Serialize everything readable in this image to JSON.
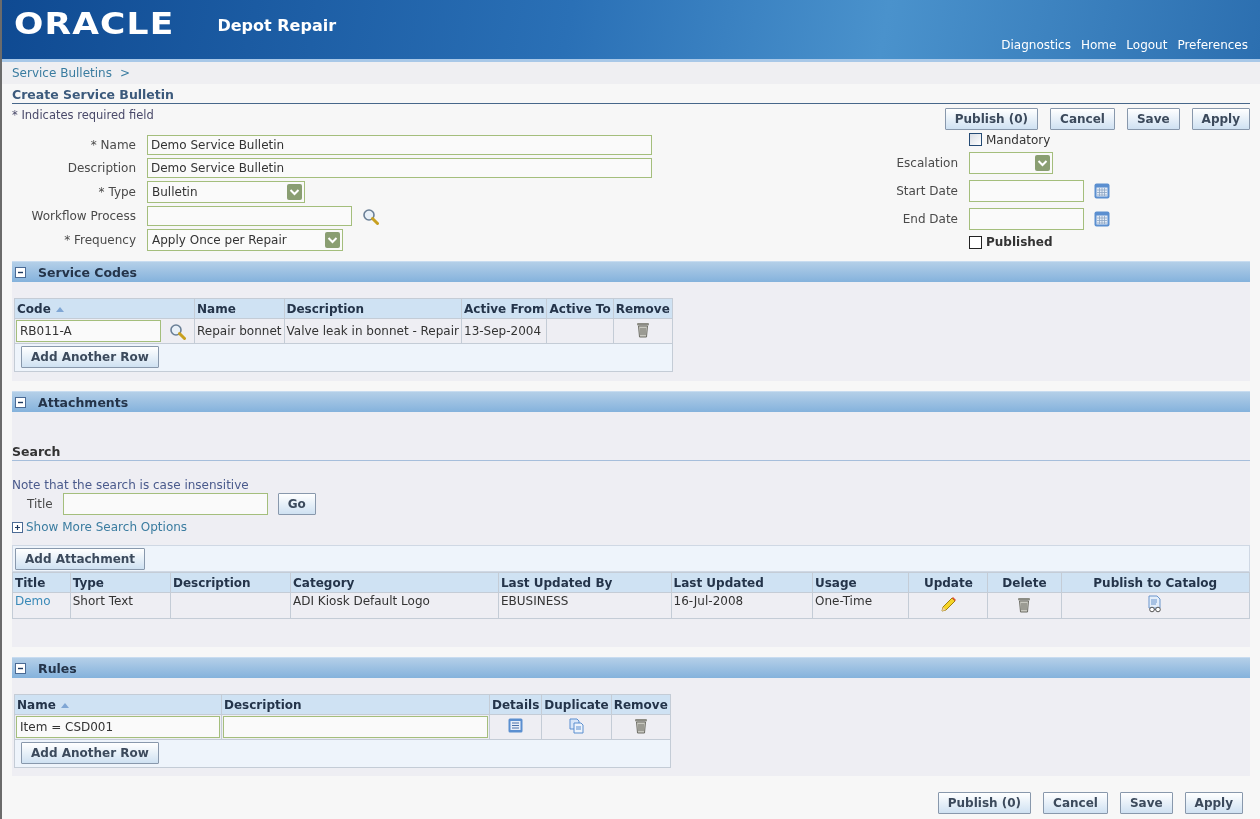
{
  "header": {
    "logo": "ORACLE",
    "app_title": "Depot Repair",
    "global_links": [
      "Diagnostics",
      "Home",
      "Logout",
      "Preferences"
    ]
  },
  "breadcrumb": {
    "items": [
      "Service Bulletins"
    ],
    "separator": ">"
  },
  "page_title": "Create Service Bulletin",
  "required_note": "* Indicates required field",
  "top_actions": [
    "Publish (0)",
    "Cancel",
    "Save",
    "Apply"
  ],
  "form_left": [
    {
      "label": "* Name",
      "kind": "text",
      "value": "Demo Service Bulletin"
    },
    {
      "label": "Description",
      "kind": "text",
      "value": "Demo Service Bulletin"
    },
    {
      "label": "* Type",
      "kind": "select",
      "value": "Bulletin"
    },
    {
      "label": "Workflow Process",
      "kind": "lov"
    },
    {
      "label": "* Frequency",
      "kind": "select",
      "value": "Apply Once per Repair"
    }
  ],
  "form_right": [
    {
      "kind": "checkbox",
      "label": "Mandatory",
      "checked": false,
      "emphasis": false
    },
    {
      "kind": "select",
      "label": "Escalation"
    },
    {
      "kind": "date",
      "label": "Start Date"
    },
    {
      "kind": "date",
      "label": "End Date"
    },
    {
      "kind": "checkbox",
      "label": "Published",
      "checked": false,
      "emphasis": true
    }
  ],
  "service_codes": {
    "title": "Service Codes",
    "columns": [
      {
        "label": "Code",
        "sorted": true
      },
      {
        "label": "Name",
        "sorted": false
      },
      {
        "label": "Description",
        "sorted": false
      },
      {
        "label": "Active From",
        "sorted": false
      },
      {
        "label": "Active To",
        "sorted": false
      },
      {
        "label": "Remove",
        "sorted": false
      }
    ],
    "rows": [
      {
        "code": "RB011-A",
        "name": "Repair bonnet",
        "description": "Valve leak in bonnet - Repair",
        "active_from": "13-Sep-2004"
      }
    ],
    "add_button": "Add Another Row"
  },
  "attachments": {
    "title": "Attachments",
    "search": {
      "heading": "Search",
      "note": "Note that the search is case insensitive",
      "title_label": "Title",
      "go_button": "Go",
      "more_options_link": "Show More Search Options"
    },
    "add_button": "Add Attachment",
    "columns": [
      "Title",
      "Type",
      "Description",
      "Category",
      "Last Updated By",
      "Last Updated",
      "Usage",
      "Update",
      "Delete",
      "Publish to Catalog"
    ],
    "rows": [
      {
        "title": "Demo",
        "type": "Short Text",
        "category": "ADI Kiosk Default Logo",
        "last_updated_by": "EBUSINESS",
        "last_updated": "16-Jul-2008",
        "usage": "One-Time"
      }
    ]
  },
  "rules": {
    "title": "Rules",
    "columns": [
      {
        "label": "Name",
        "sorted": true
      },
      {
        "label": "Description",
        "sorted": false
      },
      {
        "label": "Details",
        "sorted": false
      },
      {
        "label": "Duplicate",
        "sorted": false
      },
      {
        "label": "Remove",
        "sorted": false
      }
    ],
    "rows": [
      {
        "name": "Item = CSD001"
      }
    ],
    "add_button": "Add Another Row"
  },
  "bottom_actions": [
    "Publish (0)",
    "Cancel",
    "Save",
    "Apply"
  ]
}
